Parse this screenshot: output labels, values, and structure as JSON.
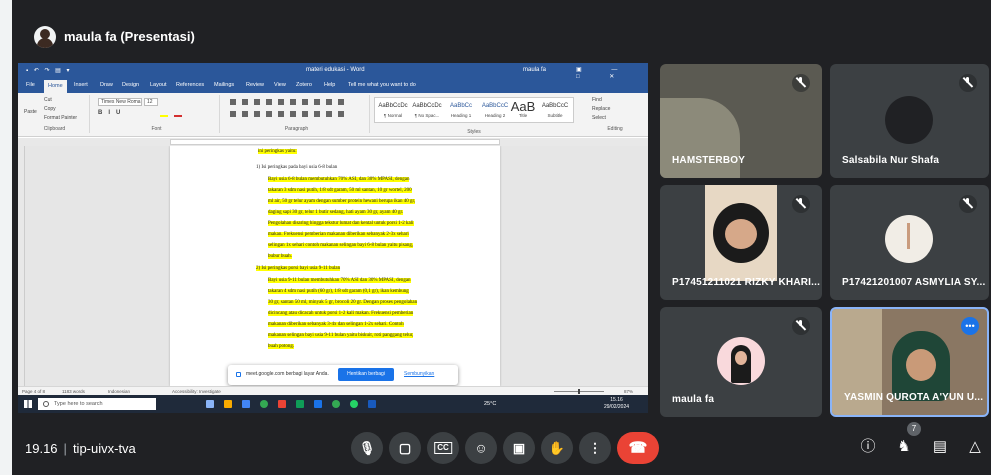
{
  "header": {
    "presenter_title": "maula fa (Presentasi)"
  },
  "word": {
    "quick_access": "▪ ↶ ↷ ▤ ▾",
    "doc_title": "materi edukasi - Word",
    "user": "maula fa",
    "window_controls": "▣ — □ ✕",
    "tabs": [
      "File",
      "Home",
      "Insert",
      "Draw",
      "Design",
      "Layout",
      "References",
      "Mailings",
      "Review",
      "View",
      "Zotero",
      "Help"
    ],
    "tell_me": "Tell me what you want to do",
    "clipboard": {
      "paste": "Paste",
      "cut": "Cut",
      "copy": "Copy",
      "format_painter": "Format Painter",
      "label": "Clipboard"
    },
    "font": {
      "name": "Times New Roma",
      "size": "12",
      "label": "Font"
    },
    "paragraph_label": "Paragraph",
    "styles": [
      {
        "sample": "AaBbCcDc",
        "name": "¶ Normal"
      },
      {
        "sample": "AaBbCcDc",
        "name": "¶ No Spac..."
      },
      {
        "sample": "AaBbCc",
        "name": "Heading 1"
      },
      {
        "sample": "AaBbCcC",
        "name": "Heading 2"
      },
      {
        "sample": "AaB",
        "name": "Title"
      },
      {
        "sample": "AaBbCcC",
        "name": "Subtitle"
      }
    ],
    "styles_label": "Styles",
    "editing": {
      "find": "Find",
      "replace": "Replace",
      "select": "Select",
      "label": "Editing"
    },
    "doc_lines": [
      "ini peringkas yaitu:",
      "1)   Isi peringkas pada bayi usia 6-8 bulan",
      "Bayi usia 6-8 bulan membutuhkan 70% ASI, dan 30% MPASI, dengan",
      "takaran 3 sdm nasi putih, 1/8 sdt garam, 50 ml santan, 10 gr wortel, 200",
      "ml air, 50 gr telur ayam dengan sumber protein hewani berupa ikan 40 gr,",
      "daging sapi 30 gr, telur 1 butir sedang, hati ayam 30 gr, ayam 40 gr.",
      "Pengolahan disaring hingga tekstur lumat dan kental untuk porsi 1-2 kali",
      "makan. Frekuensi pemberian makanan diberikan sebanyak 2-3x sehari",
      "selingan 1x sehari contoh makanan selingan bayi 6-8 bulan yaitu pisang,",
      "bubur buah.",
      "2)   Isi peringkas porsi bayi usia 9-11 bulan",
      "Bayi usia 9-11 bulan membutuhkan 70% ASI dan 30% MPASI, dengan",
      "takaran 4 sdm nasi putih (60 gr), 1/8 sdt garam (0,1 gr), ikan kembung",
      "30 gr, santan 50 ml, minyak 5 gr, brocoli 20 gr. Dengan proses pengolahan",
      "dicincang atau dicacah untuk porsi 1-2 kali makan. Frekuensi pemberian",
      "makanan diberikan sebanyak 3-4x dan selingan 1-2x sehari. Contoh",
      "makanan selingan bayi usia 9-11 bulan yaitu biskuit, roti panggang telur,",
      "buah potong."
    ],
    "share_bar": {
      "message": "meet.google.com berbagi layar Anda.",
      "stop": "Hentikan berbagi",
      "hide": "Sembunyikan"
    },
    "status": {
      "page": "Page 4 of 8",
      "words": "1183 words",
      "language": "Indonesian",
      "accessibility": "Accessibility: Investigate",
      "zoom": "87%"
    },
    "taskbar": {
      "search_placeholder": "Type here to search",
      "weather": "25°C",
      "time": "15.16",
      "date": "29/02/2024"
    }
  },
  "participants": [
    {
      "name": "HAMSTERBOY"
    },
    {
      "name": "Salsabila Nur Shafa"
    },
    {
      "name": "P17451211021 RIZKY KHARI..."
    },
    {
      "name": "P17421201007 ASMYLIA SY..."
    },
    {
      "name": "maula fa"
    },
    {
      "name": "YASMIN QUROTA A'YUN U..."
    }
  ],
  "footer": {
    "time": "19.16",
    "meeting_code": "tip-uivx-tva",
    "people_count": "7"
  },
  "colors": {
    "end_call": "#ea4335",
    "speaking": "#8ab4f8",
    "word_blue": "#2b579a",
    "highlight": "#ffff00"
  }
}
